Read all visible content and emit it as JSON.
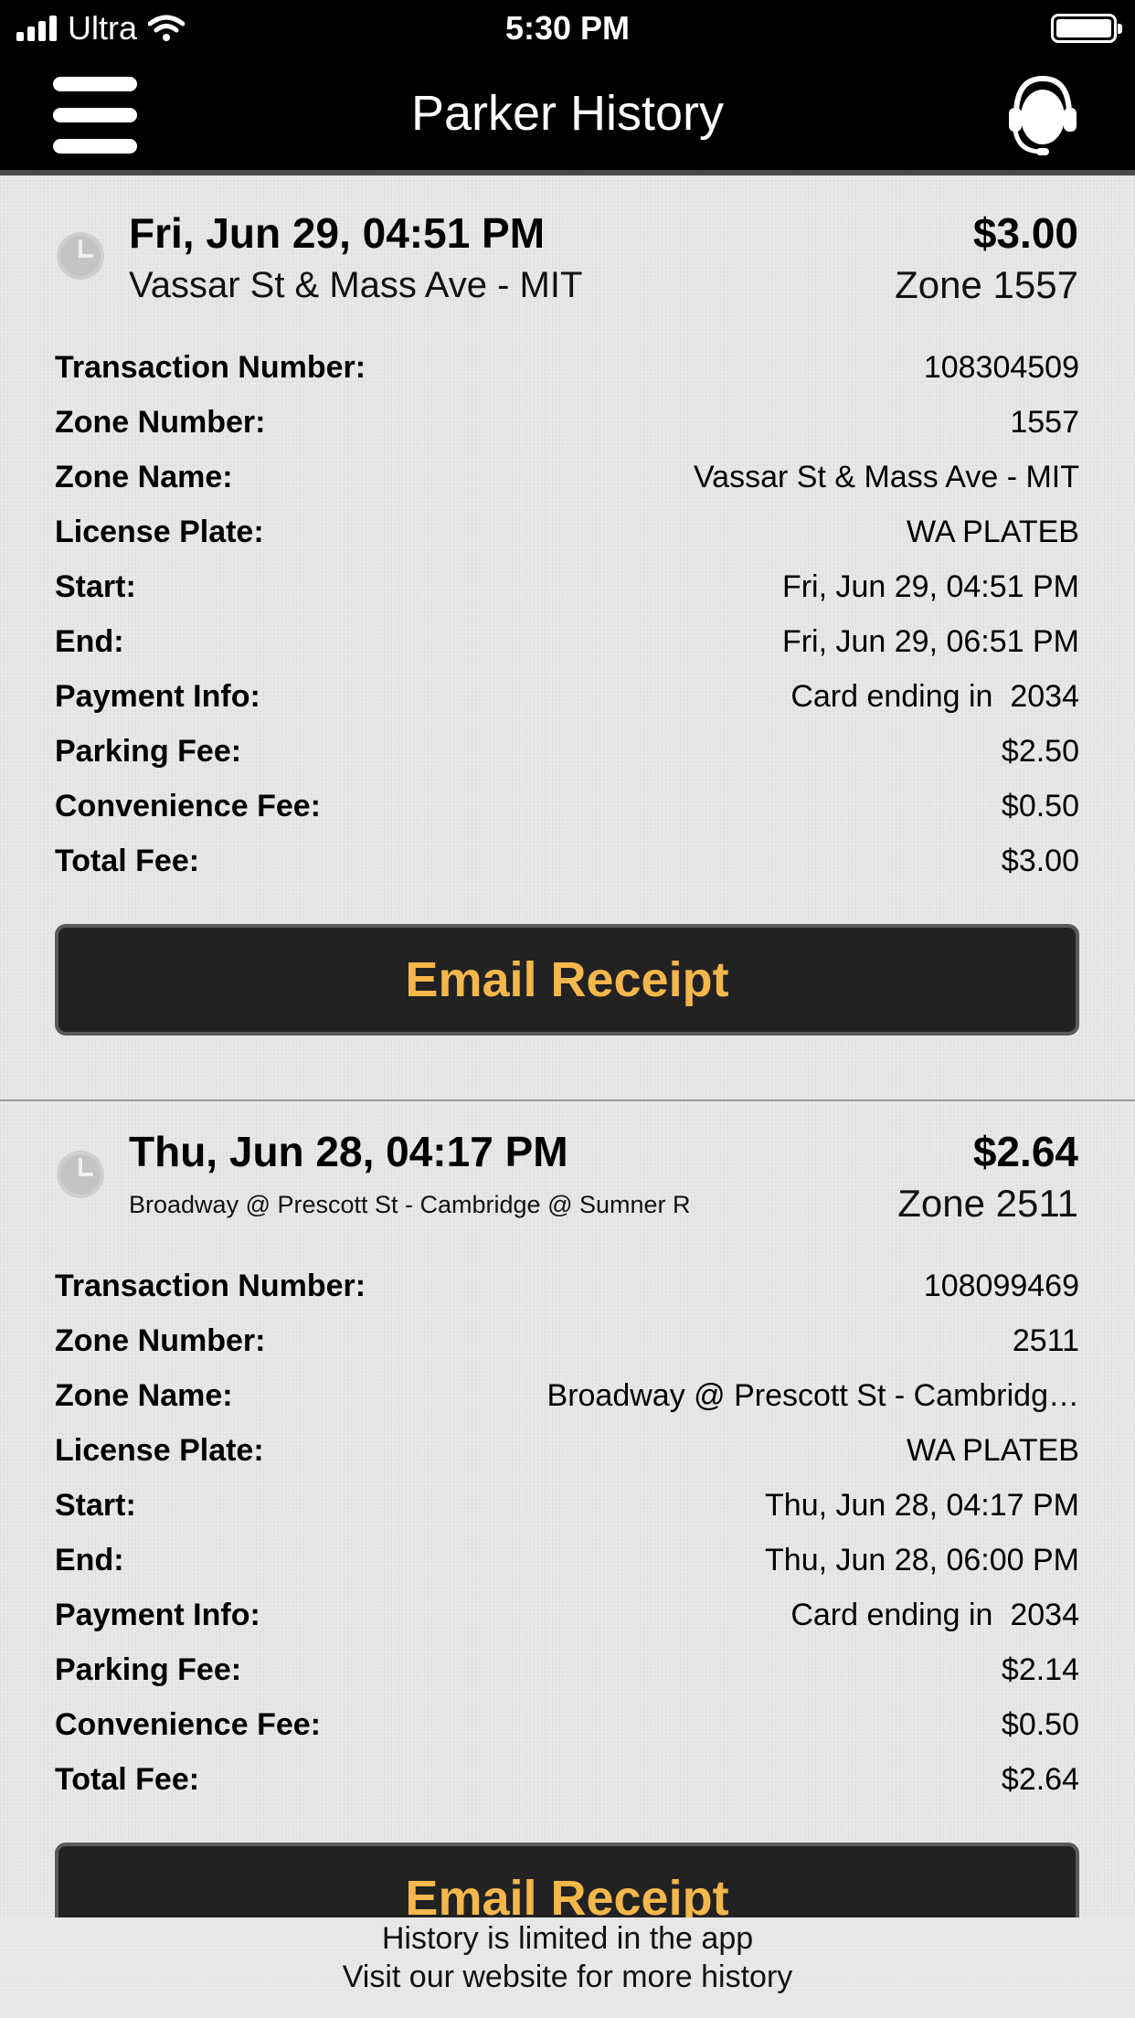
{
  "status_bar": {
    "carrier": "Ultra",
    "time": "5:30 PM"
  },
  "header": {
    "title": "Parker History"
  },
  "transactions": [
    {
      "date": "Fri, Jun 29, 04:51 PM",
      "location": "Vassar St & Mass Ave - MIT",
      "amount": "$3.00",
      "zone": "Zone 1557",
      "details": [
        {
          "label": "Transaction Number:",
          "value": "108304509"
        },
        {
          "label": "Zone Number:",
          "value": "1557"
        },
        {
          "label": "Zone Name:",
          "value": "Vassar St & Mass Ave - MIT"
        },
        {
          "label": "License Plate:",
          "value": "WA PLATEB"
        },
        {
          "label": "Start:",
          "value": "Fri, Jun 29, 04:51 PM"
        },
        {
          "label": "End:",
          "value": "Fri, Jun 29, 06:51 PM"
        },
        {
          "label": "Payment Info:",
          "value": "Card ending in  2034"
        },
        {
          "label": "Parking Fee:",
          "value": "$2.50"
        },
        {
          "label": "Convenience Fee:",
          "value": "$0.50"
        },
        {
          "label": "Total Fee:",
          "value": "$3.00"
        }
      ],
      "button_label": "Email Receipt"
    },
    {
      "date": "Thu, Jun 28, 04:17 PM",
      "location": "Broadway @ Prescott St - Cambridge @ Sumner R",
      "amount": "$2.64",
      "zone": "Zone 2511",
      "details": [
        {
          "label": "Transaction Number:",
          "value": "108099469"
        },
        {
          "label": "Zone Number:",
          "value": "2511"
        },
        {
          "label": "Zone Name:",
          "value": "Broadway @ Prescott St - Cambridg…"
        },
        {
          "label": "License Plate:",
          "value": "WA PLATEB"
        },
        {
          "label": "Start:",
          "value": "Thu, Jun 28, 04:17 PM"
        },
        {
          "label": "End:",
          "value": "Thu, Jun 28, 06:00 PM"
        },
        {
          "label": "Payment Info:",
          "value": "Card ending in  2034"
        },
        {
          "label": "Parking Fee:",
          "value": "$2.14"
        },
        {
          "label": "Convenience Fee:",
          "value": "$0.50"
        },
        {
          "label": "Total Fee:",
          "value": "$2.64"
        }
      ],
      "button_label": "Email Receipt"
    }
  ],
  "footer": {
    "line1": "History is limited in the app",
    "line2": "Visit our website for more history"
  },
  "colors": {
    "accent": "#f3b74b",
    "bar_bg": "#000000",
    "button_bg": "#222222"
  }
}
